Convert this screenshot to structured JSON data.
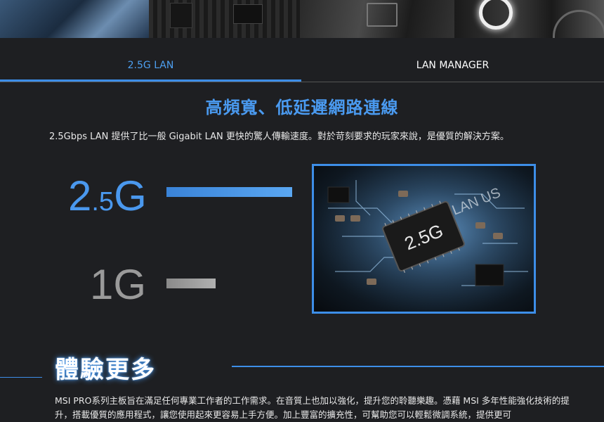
{
  "tabs": [
    {
      "label": "2.5G LAN",
      "active": true
    },
    {
      "label": "LAN MANAGER",
      "active": false
    }
  ],
  "headline": "高頻寬、低延遲網路連線",
  "description": "2.5Gbps LAN 提供了比一般 Gigabit LAN 更快的驚人傳輸速度。對於苛刻要求的玩家來說，是優質的解決方案。",
  "speed_compare": {
    "fast_big": "2",
    "fast_small": ".5",
    "fast_unit": "G",
    "slow_label": "1G",
    "fast_color": "#4a98ee",
    "slow_color": "#9a9a9a"
  },
  "chip_image": {
    "chip_label": "2.5G",
    "board_text": "LAN US"
  },
  "experience": {
    "title": "體驗更多",
    "text": "MSI PRO系列主板旨在滿足任何專業工作者的工作需求。在音質上也加以強化，提升您的聆聽樂趣。憑藉 MSI 多年性能強化技術的提升，搭載優質的應用程式，讓您使用起來更容易上手方便。加上豐富的擴充性，可幫助您可以輕鬆微調系統，提供更可"
  },
  "colors": {
    "accent": "#3d8ee8",
    "background": "#1e1f22"
  }
}
